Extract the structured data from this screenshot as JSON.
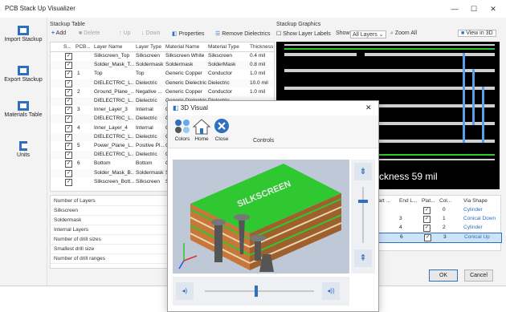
{
  "window": {
    "title": "PCB Stack Up Visualizer",
    "min": "—",
    "max": "☐",
    "close": "✕"
  },
  "sidebar": {
    "items": [
      {
        "label": "Import Stackup"
      },
      {
        "label": "Export Stackup"
      },
      {
        "label": "Materials Table"
      },
      {
        "label": "Units"
      }
    ]
  },
  "stackup_table": {
    "group_label": "Stackup Table",
    "toolbar": {
      "add": "Add",
      "delete": "Delete",
      "up": "Up",
      "down": "Down",
      "properties": "Properties",
      "remove_dielectrics": "Remove Dielectrics"
    },
    "columns": [
      "S...",
      "PCB...",
      "Layer Name",
      "Layer Type",
      "Material Name",
      "Material Type",
      "Thickness"
    ],
    "rows": [
      {
        "pcb": "",
        "name": "Silkscreen_Top",
        "type": "Silkscreen",
        "mat": "Silkscreen White",
        "mtype": "Silkscreen",
        "thick": "0.4 mil"
      },
      {
        "pcb": "",
        "name": "Solder_Mask_T...",
        "type": "Soldermask",
        "mat": "Soldermask",
        "mtype": "SolderMask",
        "thick": "0.8 mil"
      },
      {
        "pcb": "1",
        "name": "Top",
        "type": "Top",
        "mat": "Generic Copper",
        "mtype": "Conductor",
        "thick": "1.0 mil"
      },
      {
        "pcb": "",
        "name": "DIELECTRIC_L...",
        "type": "Dielectric",
        "mat": "Generic Dielectric",
        "mtype": "Dielectric",
        "thick": "10.0 mil"
      },
      {
        "pcb": "2",
        "name": "Ground_Plane_...",
        "type": "Negative ...",
        "mat": "Generic Copper",
        "mtype": "Conductor",
        "thick": "1.0 mil"
      },
      {
        "pcb": "",
        "name": "DIELECTRIC_L...",
        "type": "Dielectric",
        "mat": "Generic Dielectric",
        "mtype": "Dielectric",
        "thick": ""
      },
      {
        "pcb": "3",
        "name": "Inner_Layer_3",
        "type": "Internal",
        "mat": "G",
        "mtype": "",
        "thick": ""
      },
      {
        "pcb": "",
        "name": "DIELECTRIC_L...",
        "type": "Dielectric",
        "mat": "G",
        "mtype": "",
        "thick": ""
      },
      {
        "pcb": "4",
        "name": "Inner_Layer_4",
        "type": "Internal",
        "mat": "G",
        "mtype": "",
        "thick": ""
      },
      {
        "pcb": "",
        "name": "DIELECTRIC_L...",
        "type": "Dielectric",
        "mat": "G",
        "mtype": "",
        "thick": ""
      },
      {
        "pcb": "5",
        "name": "Power_Plane_L...",
        "type": "Positive Pl...",
        "mat": "G",
        "mtype": "",
        "thick": ""
      },
      {
        "pcb": "",
        "name": "DIELECTRIC_L...",
        "type": "Dielectric",
        "mat": "G",
        "mtype": "",
        "thick": ""
      },
      {
        "pcb": "6",
        "name": "Bottom",
        "type": "Bottom",
        "mat": "G",
        "mtype": "",
        "thick": ""
      },
      {
        "pcb": "",
        "name": "Solder_Mask_B...",
        "type": "Soldermask",
        "mat": "S",
        "mtype": "",
        "thick": ""
      },
      {
        "pcb": "",
        "name": "Silkscreen_Bott...",
        "type": "Silkscreen",
        "mat": "S",
        "mtype": "",
        "thick": ""
      }
    ]
  },
  "properties": [
    "Number of Layers",
    "Silkscreen",
    "Soldermask",
    "Internal Layers",
    "Number of drill sizes",
    "Smallest drill size",
    "Number of drill ranges"
  ],
  "graphics": {
    "group_label": "Stackup Graphics",
    "show_layer_labels": "Show Layer Labels",
    "show_label": "Show",
    "show_value": "All Layers",
    "zoom_all": "Zoom All",
    "view_3d": "View in 3D",
    "overlay_text": "ckness 59 mil"
  },
  "vias": {
    "columns": [
      "Start ...",
      "End L...",
      "Plat...",
      "Col...",
      "Via Shape"
    ],
    "rows": [
      {
        "start": "",
        "end": "",
        "col": "0",
        "shape": "Cylinder"
      },
      {
        "start": ")",
        "end": "3",
        "col": "1",
        "shape": "Conical Down"
      },
      {
        "start": ")",
        "end": "4",
        "col": "2",
        "shape": "Cylinder"
      },
      {
        "start": "3",
        "end": "6",
        "col": "3",
        "shape": "Conical Up"
      }
    ]
  },
  "footer": {
    "ok": "OK",
    "cancel": "Cancel"
  },
  "dialog": {
    "title": "3D Visual",
    "buttons": {
      "colors": "Colors",
      "home": "Home",
      "close": "Close"
    },
    "controls_label": "Controls",
    "silkscreen_text": "SILKSCREEN",
    "close_glyph": "✕"
  },
  "colors": {
    "accent": "#2f6fc0",
    "board_green": "#2fc830",
    "copper": "#c8763a",
    "selection": "#cce4f7"
  }
}
